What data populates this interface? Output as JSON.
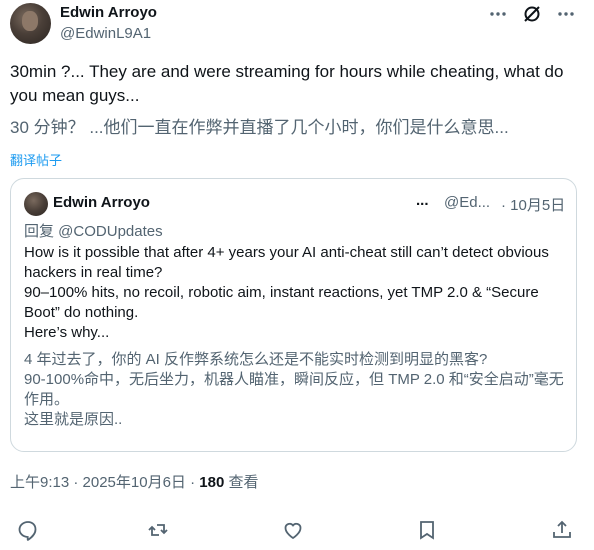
{
  "author": {
    "name": "Edwin Arroyo",
    "handle": "@EdwinL9A1"
  },
  "tweet": {
    "text": "30min ?... They are and were streaming for hours while cheating, what do you mean guys...",
    "translation": "30 分钟？ ...他们一直在作弊并直播了几个小时，你们是什么意思...",
    "translate_link": "翻译帖子"
  },
  "quote": {
    "name": "Edwin Arroyo",
    "dots": "...",
    "handle": "@Ed...",
    "date": "· 10月5日",
    "reply_prefix": "回复 ",
    "reply_mention": "@CODUpdates",
    "body": "How is it possible that after 4+ years your AI anti-cheat still can’t detect obvious hackers in real time?\n90–100% hits, no recoil, robotic aim, instant reactions, yet TMP 2.0 & “Secure Boot” do nothing.\nHere’s why...",
    "translation": "4 年过去了，你的 AI 反作弊系统怎么还是不能实时检测到明显的黑客?\n90-100%命中，无后坐力，机器人瞄准，瞬间反应，但 TMP 2.0 和“安全启动”毫无作用。\n这里就是原因.."
  },
  "meta": {
    "time": "上午9:13 · 2025年10月6日 · ",
    "views": "180",
    "views_label": " 查看"
  },
  "icons": {
    "top": [
      "grok-icon",
      "more-icon"
    ],
    "actions": [
      "reply-icon",
      "retweet-icon",
      "like-icon",
      "bookmark-icon",
      "share-icon"
    ]
  },
  "colors": {
    "text": "#0f1419",
    "secondary": "#536471",
    "link": "#1d9bf0",
    "border": "#cfd9de"
  }
}
